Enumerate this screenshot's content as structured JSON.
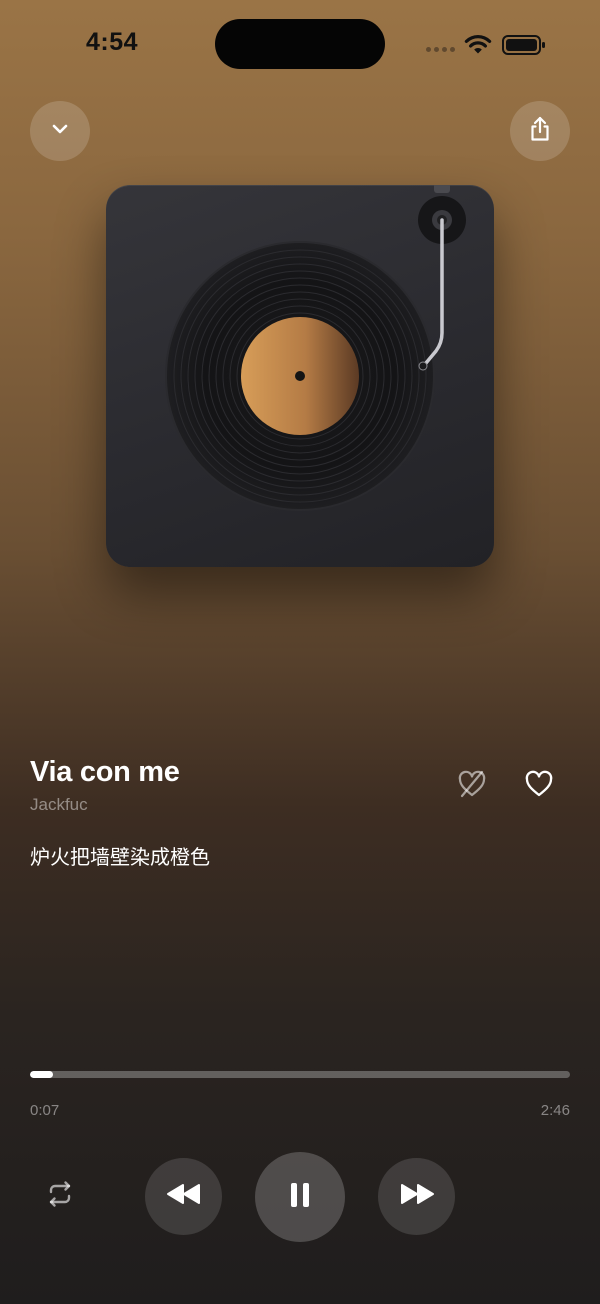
{
  "status_bar": {
    "time": "4:54"
  },
  "header": {
    "collapse_icon": "chevron-down-icon",
    "share_icon": "share-icon"
  },
  "artwork": {
    "type": "turntable-illustration",
    "label_color": "#c88f4f"
  },
  "track": {
    "title": "Via con me",
    "artist": "Jackfuc",
    "lyric": "炉火把墙壁染成橙色"
  },
  "actions": {
    "dislike_icon": "heart-slash-icon",
    "like_icon": "heart-icon"
  },
  "progress": {
    "elapsed": "0:07",
    "total": "2:46",
    "fraction": 0.042
  },
  "controls": {
    "repeat_icon": "repeat-icon",
    "previous_icon": "rewind-icon",
    "play_state_icon": "pause-icon",
    "next_icon": "fast-forward-icon"
  },
  "colors": {
    "background_top": "#9a7446",
    "background_bottom": "#1f1d1d",
    "accent": "#ffffff"
  }
}
